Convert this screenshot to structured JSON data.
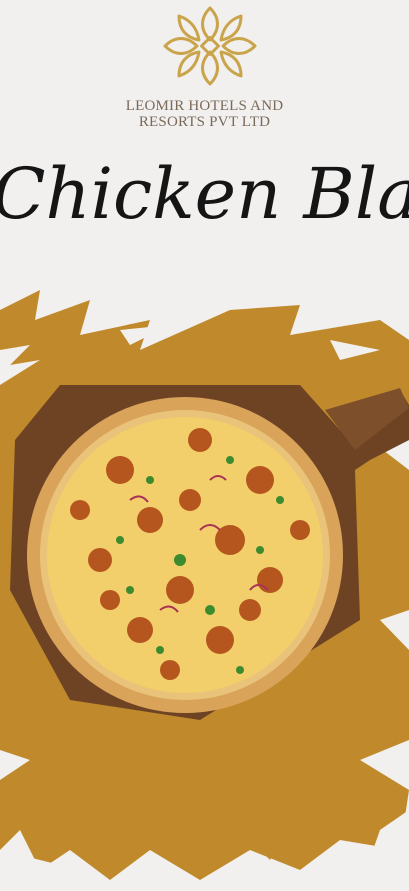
{
  "brand": {
    "line1": "LEOMIR HOTELS AND",
    "line2": "RESORTS PVT LTD"
  },
  "title": "Chicken Blast Pizza",
  "icons": {
    "logo": "floral-lotus-logo-icon"
  },
  "colors": {
    "background": "#f1f0ee",
    "brush": "#c08a2c",
    "logo": "#c9a44a",
    "title": "#151515",
    "brand_text": "#7a6a5a"
  }
}
